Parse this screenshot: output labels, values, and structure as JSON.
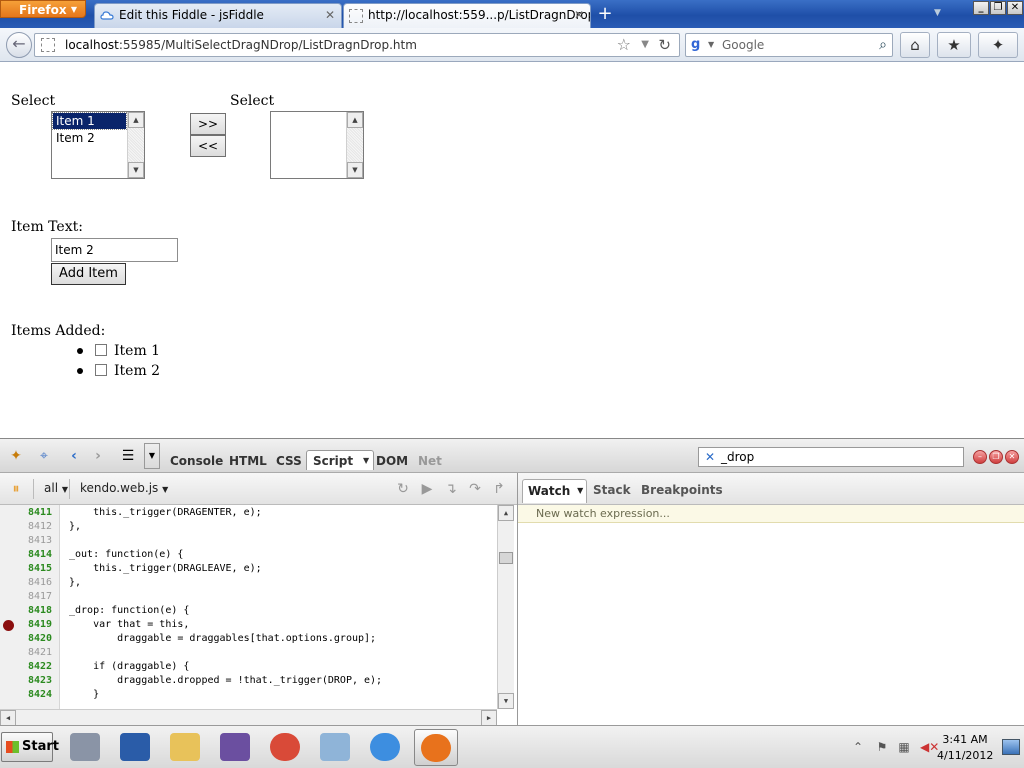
{
  "browser": {
    "menu_button": "Firefox",
    "tabs": [
      {
        "title": "Edit this Fiddle - jsFiddle",
        "active": false
      },
      {
        "title": "http://localhost:559...p/ListDragnDrop.htm",
        "active": true
      }
    ],
    "url_host": "localhost",
    "url_rest": ":55985/MultiSelectDragNDrop/ListDragnDrop.htm",
    "search_placeholder": "Google"
  },
  "page": {
    "left_select_label": "Select",
    "right_select_label": "Select",
    "left_options": [
      "Item 1",
      "Item 2"
    ],
    "selected_option": "Item 1",
    "move_right_label": ">>",
    "move_left_label": "<<",
    "item_text_label": "Item Text:",
    "item_text_value": "Item 2",
    "add_button_label": "Add Item",
    "items_added_label": "Items Added:",
    "items_added": [
      "Item 1",
      "Item 2"
    ]
  },
  "firebug": {
    "panel_tabs": [
      "Console",
      "HTML",
      "CSS",
      "Script",
      "DOM",
      "Net"
    ],
    "active_panel": "Script",
    "search_value": "_drop",
    "filter_label": "all",
    "script_file": "kendo.web.js",
    "code_lines": [
      {
        "num": "8411",
        "exec": true,
        "bp": false,
        "code": "    this._trigger(DRAGENTER, e);"
      },
      {
        "num": "8412",
        "exec": false,
        "bp": false,
        "code": "},"
      },
      {
        "num": "8413",
        "exec": false,
        "bp": false,
        "code": ""
      },
      {
        "num": "8414",
        "exec": true,
        "bp": false,
        "code": "_out: function(e) {"
      },
      {
        "num": "8415",
        "exec": true,
        "bp": false,
        "code": "    this._trigger(DRAGLEAVE, e);"
      },
      {
        "num": "8416",
        "exec": false,
        "bp": false,
        "code": "},"
      },
      {
        "num": "8417",
        "exec": false,
        "bp": false,
        "code": ""
      },
      {
        "num": "8418",
        "exec": true,
        "bp": false,
        "code": "_drop: function(e) {"
      },
      {
        "num": "8419",
        "exec": true,
        "bp": true,
        "code": "    var that = this,"
      },
      {
        "num": "8420",
        "exec": true,
        "bp": false,
        "code": "        draggable = draggables[that.options.group];"
      },
      {
        "num": "8421",
        "exec": false,
        "bp": false,
        "code": ""
      },
      {
        "num": "8422",
        "exec": true,
        "bp": false,
        "code": "    if (draggable) {"
      },
      {
        "num": "8423",
        "exec": true,
        "bp": false,
        "code": "        draggable.dropped = !that._trigger(DROP, e);"
      },
      {
        "num": "8424",
        "exec": true,
        "bp": false,
        "code": "    }"
      }
    ],
    "side_tabs": [
      "Watch",
      "Stack",
      "Breakpoints"
    ],
    "active_side_tab": "Watch",
    "new_watch_placeholder": "New watch expression..."
  },
  "taskbar": {
    "start_label": "Start",
    "apps": [
      {
        "name": "server-manager",
        "color": "#8a94a6"
      },
      {
        "name": "powershell",
        "color": "#2a5ca8"
      },
      {
        "name": "file-explorer",
        "color": "#e8c25a"
      },
      {
        "name": "visual-studio",
        "color": "#6b4fa0"
      },
      {
        "name": "chrome",
        "color": "#d94a38"
      },
      {
        "name": "notepad",
        "color": "#8fb4d8"
      },
      {
        "name": "internet-explorer",
        "color": "#3d8ee0"
      },
      {
        "name": "firefox",
        "color": "#e8721c"
      }
    ],
    "clock_time": "3:41 AM",
    "clock_date": "4/11/2012"
  }
}
